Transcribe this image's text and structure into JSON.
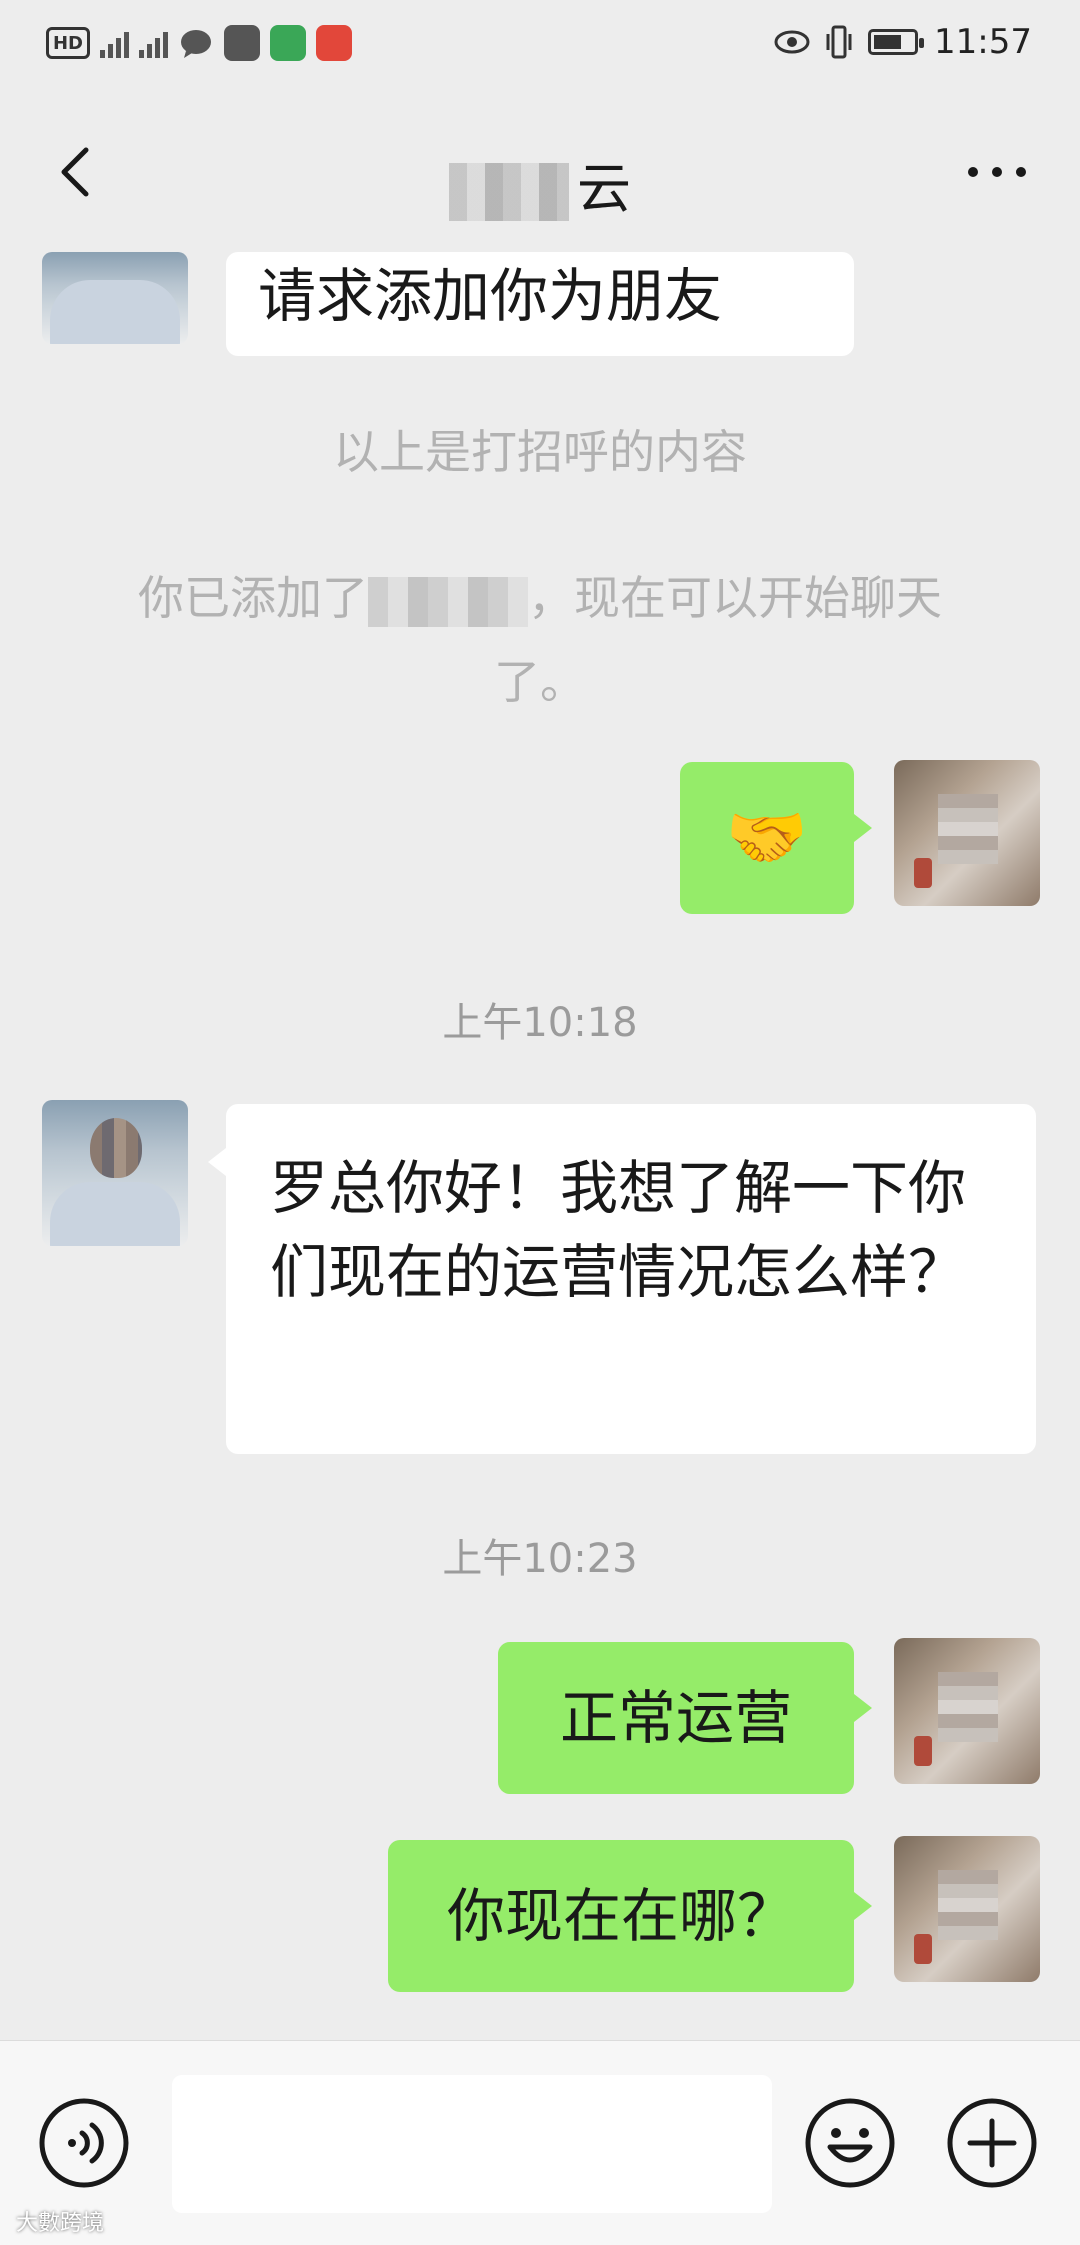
{
  "status_bar": {
    "hd_label": "HD",
    "time": "11:57"
  },
  "nav": {
    "title": "云"
  },
  "messages": {
    "friend_request": "请求添加你为朋友",
    "greeting_note": "以上是打招呼的内容",
    "added_note_prefix": "你已添加了",
    "added_note_suffix": "，现在可以开始聊天了。",
    "handshake_emoji": "🤝",
    "time_1": "上午10:18",
    "msg_other_1": "罗总你好！我想了解一下你们现在的运营情况怎么样？",
    "time_2": "上午10:23",
    "msg_me_1": "正常运营",
    "msg_me_2": "你现在在哪？"
  },
  "input": {
    "placeholder": ""
  },
  "watermark": "大數跨境",
  "colors": {
    "background": "#ededed",
    "bubble_green": "#95ec69",
    "bubble_white": "#ffffff"
  }
}
